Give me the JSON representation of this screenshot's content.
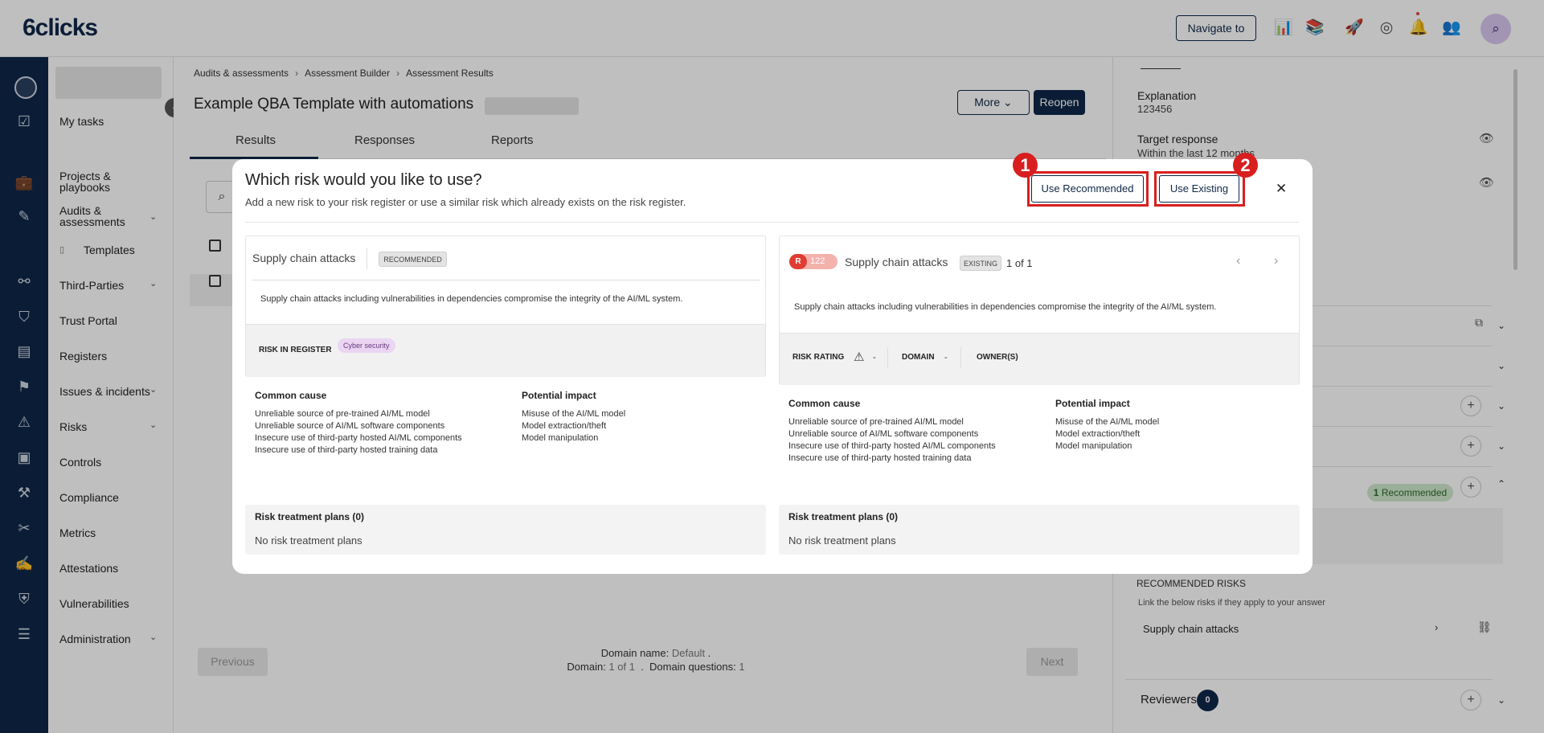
{
  "topbar": {
    "logo": "6clicks",
    "navigate_label": "Navigate to",
    "icons": [
      "analytics-icon",
      "library-icon",
      "rocket-icon",
      "support-icon",
      "bell-icon",
      "user-settings-icon",
      "profile-avatar-icon"
    ]
  },
  "rail": {
    "icons": [
      "tasks-icon",
      "briefcase-icon",
      "edit-icon",
      "network-icon",
      "trust-portal-icon",
      "register-icon",
      "issues-icon",
      "risk-warning-icon",
      "controls-icon",
      "compliance-icon",
      "metrics-icon",
      "attestations-icon",
      "vulnerabilities-shield-icon",
      "administration-sliders-icon"
    ]
  },
  "menu": {
    "items": [
      {
        "label": "My tasks"
      },
      {
        "label": "Projects & playbooks"
      },
      {
        "label": "Audits & assessments"
      },
      {
        "label": "Templates"
      },
      {
        "label": "Third-Parties"
      },
      {
        "label": "Trust Portal"
      },
      {
        "label": "Registers"
      },
      {
        "label": "Issues & incidents"
      },
      {
        "label": "Risks"
      },
      {
        "label": "Controls"
      },
      {
        "label": "Compliance"
      },
      {
        "label": "Metrics"
      },
      {
        "label": "Attestations"
      },
      {
        "label": "Vulnerabilities"
      },
      {
        "label": "Administration"
      }
    ]
  },
  "main": {
    "breadcrumb": [
      "Audits & assessments",
      "Assessment Builder",
      "Assessment Results"
    ],
    "title": "Example QBA Template with automations",
    "more_label": "More",
    "reopen_label": "Reopen",
    "tabs": [
      "Results",
      "Responses",
      "Reports"
    ],
    "previous_label": "Previous",
    "next_label": "Next",
    "domain_name_label": "Domain name:",
    "domain_name_value": "Default",
    "domain_label": "Domain:",
    "domain_value": "1 of 1",
    "domain_questions_label": "Domain questions:",
    "domain_questions_value": "1"
  },
  "rpanel": {
    "explanation_label": "Explanation",
    "explanation_value": "123456",
    "target_label": "Target response",
    "target_value": "Within the last 12 months",
    "recommended_badge_count": "1",
    "recommended_badge_label": "Recommended",
    "recommended_risks_heading": "RECOMMENDED RISKS",
    "recommended_risks_sub": "Link the below risks if they apply to your answer",
    "recommended_risk_item": "Supply chain attacks",
    "reviewers_label": "Reviewers",
    "reviewers_count": "0"
  },
  "modal": {
    "title": "Which risk would you like to use?",
    "subtitle": "Add a new risk to your risk register or use a similar risk which already exists on the risk register.",
    "use_recommended": "Use Recommended",
    "use_existing": "Use Existing",
    "marker_1": "1",
    "marker_2": "2",
    "left": {
      "title": "Supply chain attacks",
      "tag": "RECOMMENDED",
      "description": "Supply chain attacks including vulnerabilities in dependencies compromise the integrity of the AI/ML system.",
      "register_label": "RISK IN REGISTER",
      "register_tag": "Cyber security",
      "cause_heading": "Common cause",
      "causes": [
        "Unreliable source of pre-trained AI/ML model",
        "Unreliable source of AI/ML software components",
        "Insecure use of third-party hosted AI/ML components",
        "Insecure use of third-party hosted training data"
      ],
      "impact_heading": "Potential impact",
      "impacts": [
        "Misuse of the AI/ML model",
        "Model extraction/theft",
        "Model manipulation"
      ],
      "treatment_heading": "Risk treatment plans (0)",
      "treatment_none": "No risk treatment plans"
    },
    "right": {
      "risk_prefix": "R",
      "risk_number": "122",
      "title": "Supply chain attacks",
      "tag": "EXISTING",
      "counter": "1 of 1",
      "description": "Supply chain attacks including vulnerabilities in dependencies compromise the integrity of the AI/ML system.",
      "risk_rating_label": "RISK RATING",
      "risk_rating_value": "-",
      "domain_label": "DOMAIN",
      "domain_value": "-",
      "owners_label": "OWNER(S)",
      "cause_heading": "Common cause",
      "causes": [
        "Unreliable source of pre-trained AI/ML model",
        "Unreliable source of AI/ML software components",
        "Insecure use of third-party hosted AI/ML components",
        "Insecure use of third-party hosted training data"
      ],
      "impact_heading": "Potential impact",
      "impacts": [
        "Misuse of the AI/ML model",
        "Model extraction/theft",
        "Model manipulation"
      ],
      "treatment_heading": "Risk treatment plans (0)",
      "treatment_none": "No risk treatment plans"
    }
  }
}
